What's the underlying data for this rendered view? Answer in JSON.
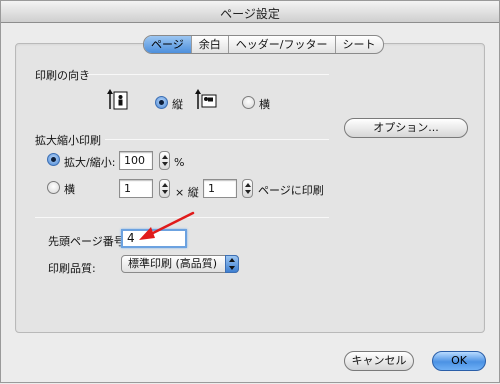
{
  "window": {
    "title": "ページ設定"
  },
  "tabs": [
    {
      "label": "ページ",
      "active": true
    },
    {
      "label": "余白",
      "active": false
    },
    {
      "label": "ヘッダー/フッター",
      "active": false
    },
    {
      "label": "シート",
      "active": false
    }
  ],
  "orientation": {
    "section_label": "印刷の向き",
    "portrait_label": "縦",
    "landscape_label": "横",
    "selected": "portrait",
    "portrait_icon": "portrait-orientation-icon",
    "landscape_icon": "landscape-orientation-icon"
  },
  "options_button": {
    "label": "オプション..."
  },
  "scaling": {
    "section_label": "拡大縮小印刷",
    "adjust_label": "拡大/縮小:",
    "adjust_value": "100",
    "percent_symbol": "%",
    "fit_label": "横",
    "fit_width_value": "1",
    "times_label": "× 縦",
    "fit_height_value": "1",
    "fit_suffix": "ページに印刷",
    "selected": "adjust"
  },
  "first_page": {
    "label": "先頭ページ番号:",
    "value": "4"
  },
  "quality": {
    "label": "印刷品質:",
    "selected": "標準印刷 (高品質)"
  },
  "footer": {
    "cancel_label": "キャンセル",
    "ok_label": "OK"
  },
  "colors": {
    "accent": "#4d8fdc",
    "annotation_arrow": "#e01b1b"
  }
}
